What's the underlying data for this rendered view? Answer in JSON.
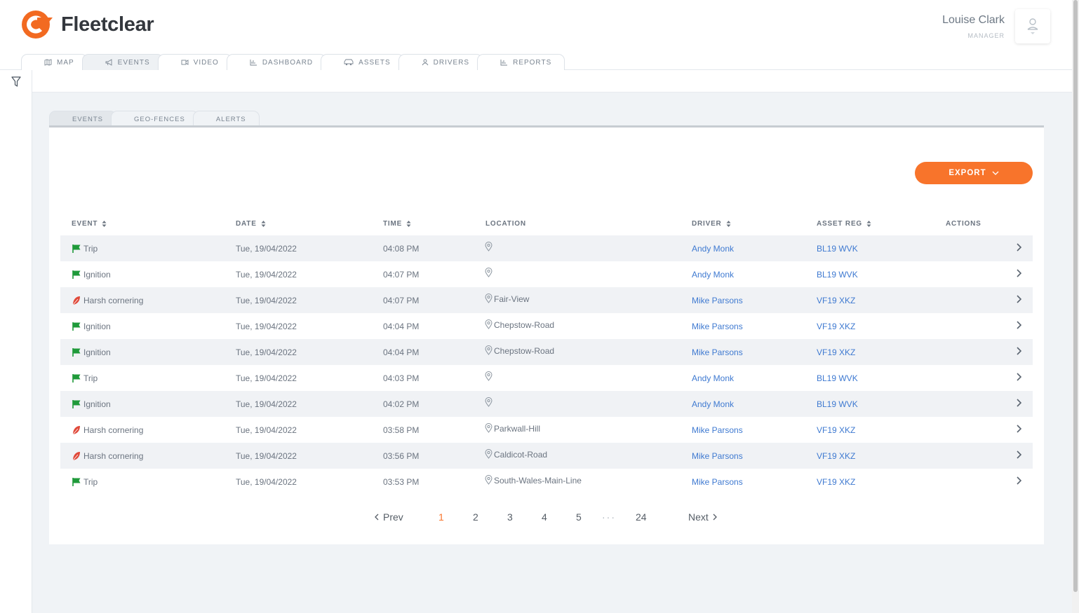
{
  "app": {
    "brand": "Fleetclear",
    "brand_color": "#f8742b"
  },
  "user": {
    "name": "Louise Clark",
    "role": "MANAGER"
  },
  "nav": {
    "tabs": [
      {
        "label": "MAP",
        "icon": "map-icon"
      },
      {
        "label": "EVENTS",
        "icon": "megaphone-icon",
        "active": true
      },
      {
        "label": "VIDEO",
        "icon": "video-icon"
      },
      {
        "label": "DASHBOARD",
        "icon": "dashboard-icon"
      },
      {
        "label": "ASSETS",
        "icon": "car-icon"
      },
      {
        "label": "DRIVERS",
        "icon": "person-icon"
      },
      {
        "label": "REPORTS",
        "icon": "report-icon"
      }
    ]
  },
  "subtabs": [
    {
      "label": "EVENTS",
      "active": true
    },
    {
      "label": "GEO-FENCES"
    },
    {
      "label": "ALERTS"
    }
  ],
  "export": {
    "label": "EXPORT"
  },
  "table": {
    "columns": {
      "event": "EVENT",
      "date": "DATE",
      "time": "TIME",
      "location": "LOCATION",
      "driver": "DRIVER",
      "asset": "ASSET REG",
      "actions": "ACTIONS"
    },
    "rows": [
      {
        "type": "flag",
        "event": "Trip",
        "date": "Tue, 19/04/2022",
        "time": "04:08 PM",
        "location": "",
        "driver": "Andy Monk",
        "asset": "BL19 WVK"
      },
      {
        "type": "flag",
        "event": "Ignition",
        "date": "Tue, 19/04/2022",
        "time": "04:07 PM",
        "location": "",
        "driver": "Andy Monk",
        "asset": "BL19 WVK"
      },
      {
        "type": "leaf",
        "event": "Harsh cornering",
        "date": "Tue, 19/04/2022",
        "time": "04:07 PM",
        "location": "Fair-View",
        "driver": "Mike Parsons",
        "asset": "VF19 XKZ"
      },
      {
        "type": "flag",
        "event": "Ignition",
        "date": "Tue, 19/04/2022",
        "time": "04:04 PM",
        "location": "Chepstow-Road",
        "driver": "Mike Parsons",
        "asset": "VF19 XKZ"
      },
      {
        "type": "flag",
        "event": "Ignition",
        "date": "Tue, 19/04/2022",
        "time": "04:04 PM",
        "location": "Chepstow-Road",
        "driver": "Mike Parsons",
        "asset": "VF19 XKZ"
      },
      {
        "type": "flag",
        "event": "Trip",
        "date": "Tue, 19/04/2022",
        "time": "04:03 PM",
        "location": "",
        "driver": "Andy Monk",
        "asset": "BL19 WVK"
      },
      {
        "type": "flag",
        "event": "Ignition",
        "date": "Tue, 19/04/2022",
        "time": "04:02 PM",
        "location": "",
        "driver": "Andy Monk",
        "asset": "BL19 WVK"
      },
      {
        "type": "leaf",
        "event": "Harsh cornering",
        "date": "Tue, 19/04/2022",
        "time": "03:58 PM",
        "location": "Parkwall-Hill",
        "driver": "Mike Parsons",
        "asset": "VF19 XKZ"
      },
      {
        "type": "leaf",
        "event": "Harsh cornering",
        "date": "Tue, 19/04/2022",
        "time": "03:56 PM",
        "location": "Caldicot-Road",
        "driver": "Mike Parsons",
        "asset": "VF19 XKZ"
      },
      {
        "type": "flag",
        "event": "Trip",
        "date": "Tue, 19/04/2022",
        "time": "03:53 PM",
        "location": "South-Wales-Main-Line",
        "driver": "Mike Parsons",
        "asset": "VF19 XKZ"
      }
    ]
  },
  "pagination": {
    "prev": "Prev",
    "next": "Next",
    "pages": [
      "1",
      "2",
      "3",
      "4",
      "5"
    ],
    "ellipsis": "···",
    "last": "24",
    "current": "1"
  },
  "colors": {
    "flag_green": "#1f9a3a",
    "leaf_red": "#e0493a",
    "link_blue": "#3f7ad1"
  }
}
